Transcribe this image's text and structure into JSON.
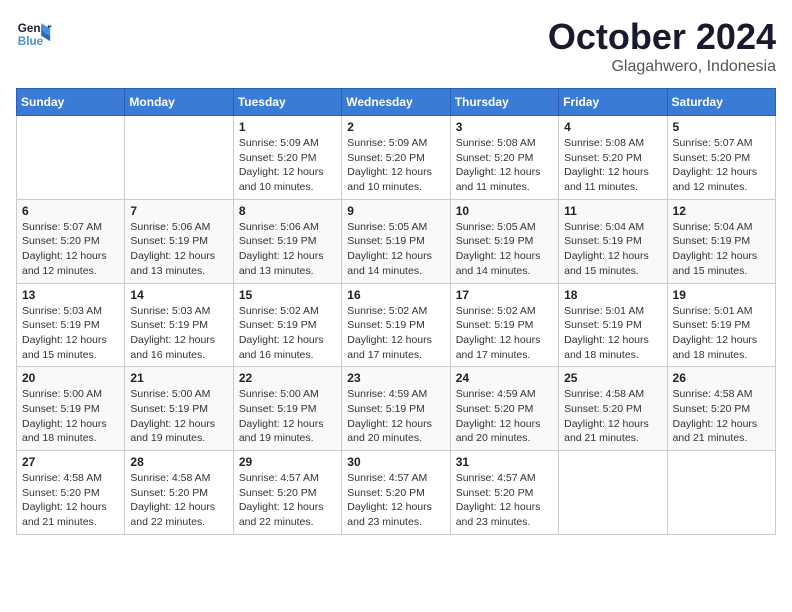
{
  "header": {
    "logo_line1": "General",
    "logo_line2": "Blue",
    "month": "October 2024",
    "location": "Glagahwero, Indonesia"
  },
  "weekdays": [
    "Sunday",
    "Monday",
    "Tuesday",
    "Wednesday",
    "Thursday",
    "Friday",
    "Saturday"
  ],
  "weeks": [
    [
      {
        "day": "",
        "info": ""
      },
      {
        "day": "",
        "info": ""
      },
      {
        "day": "1",
        "info": "Sunrise: 5:09 AM\nSunset: 5:20 PM\nDaylight: 12 hours\nand 10 minutes."
      },
      {
        "day": "2",
        "info": "Sunrise: 5:09 AM\nSunset: 5:20 PM\nDaylight: 12 hours\nand 10 minutes."
      },
      {
        "day": "3",
        "info": "Sunrise: 5:08 AM\nSunset: 5:20 PM\nDaylight: 12 hours\nand 11 minutes."
      },
      {
        "day": "4",
        "info": "Sunrise: 5:08 AM\nSunset: 5:20 PM\nDaylight: 12 hours\nand 11 minutes."
      },
      {
        "day": "5",
        "info": "Sunrise: 5:07 AM\nSunset: 5:20 PM\nDaylight: 12 hours\nand 12 minutes."
      }
    ],
    [
      {
        "day": "6",
        "info": "Sunrise: 5:07 AM\nSunset: 5:20 PM\nDaylight: 12 hours\nand 12 minutes."
      },
      {
        "day": "7",
        "info": "Sunrise: 5:06 AM\nSunset: 5:19 PM\nDaylight: 12 hours\nand 13 minutes."
      },
      {
        "day": "8",
        "info": "Sunrise: 5:06 AM\nSunset: 5:19 PM\nDaylight: 12 hours\nand 13 minutes."
      },
      {
        "day": "9",
        "info": "Sunrise: 5:05 AM\nSunset: 5:19 PM\nDaylight: 12 hours\nand 14 minutes."
      },
      {
        "day": "10",
        "info": "Sunrise: 5:05 AM\nSunset: 5:19 PM\nDaylight: 12 hours\nand 14 minutes."
      },
      {
        "day": "11",
        "info": "Sunrise: 5:04 AM\nSunset: 5:19 PM\nDaylight: 12 hours\nand 15 minutes."
      },
      {
        "day": "12",
        "info": "Sunrise: 5:04 AM\nSunset: 5:19 PM\nDaylight: 12 hours\nand 15 minutes."
      }
    ],
    [
      {
        "day": "13",
        "info": "Sunrise: 5:03 AM\nSunset: 5:19 PM\nDaylight: 12 hours\nand 15 minutes."
      },
      {
        "day": "14",
        "info": "Sunrise: 5:03 AM\nSunset: 5:19 PM\nDaylight: 12 hours\nand 16 minutes."
      },
      {
        "day": "15",
        "info": "Sunrise: 5:02 AM\nSunset: 5:19 PM\nDaylight: 12 hours\nand 16 minutes."
      },
      {
        "day": "16",
        "info": "Sunrise: 5:02 AM\nSunset: 5:19 PM\nDaylight: 12 hours\nand 17 minutes."
      },
      {
        "day": "17",
        "info": "Sunrise: 5:02 AM\nSunset: 5:19 PM\nDaylight: 12 hours\nand 17 minutes."
      },
      {
        "day": "18",
        "info": "Sunrise: 5:01 AM\nSunset: 5:19 PM\nDaylight: 12 hours\nand 18 minutes."
      },
      {
        "day": "19",
        "info": "Sunrise: 5:01 AM\nSunset: 5:19 PM\nDaylight: 12 hours\nand 18 minutes."
      }
    ],
    [
      {
        "day": "20",
        "info": "Sunrise: 5:00 AM\nSunset: 5:19 PM\nDaylight: 12 hours\nand 18 minutes."
      },
      {
        "day": "21",
        "info": "Sunrise: 5:00 AM\nSunset: 5:19 PM\nDaylight: 12 hours\nand 19 minutes."
      },
      {
        "day": "22",
        "info": "Sunrise: 5:00 AM\nSunset: 5:19 PM\nDaylight: 12 hours\nand 19 minutes."
      },
      {
        "day": "23",
        "info": "Sunrise: 4:59 AM\nSunset: 5:19 PM\nDaylight: 12 hours\nand 20 minutes."
      },
      {
        "day": "24",
        "info": "Sunrise: 4:59 AM\nSunset: 5:20 PM\nDaylight: 12 hours\nand 20 minutes."
      },
      {
        "day": "25",
        "info": "Sunrise: 4:58 AM\nSunset: 5:20 PM\nDaylight: 12 hours\nand 21 minutes."
      },
      {
        "day": "26",
        "info": "Sunrise: 4:58 AM\nSunset: 5:20 PM\nDaylight: 12 hours\nand 21 minutes."
      }
    ],
    [
      {
        "day": "27",
        "info": "Sunrise: 4:58 AM\nSunset: 5:20 PM\nDaylight: 12 hours\nand 21 minutes."
      },
      {
        "day": "28",
        "info": "Sunrise: 4:58 AM\nSunset: 5:20 PM\nDaylight: 12 hours\nand 22 minutes."
      },
      {
        "day": "29",
        "info": "Sunrise: 4:57 AM\nSunset: 5:20 PM\nDaylight: 12 hours\nand 22 minutes."
      },
      {
        "day": "30",
        "info": "Sunrise: 4:57 AM\nSunset: 5:20 PM\nDaylight: 12 hours\nand 23 minutes."
      },
      {
        "day": "31",
        "info": "Sunrise: 4:57 AM\nSunset: 5:20 PM\nDaylight: 12 hours\nand 23 minutes."
      },
      {
        "day": "",
        "info": ""
      },
      {
        "day": "",
        "info": ""
      }
    ]
  ]
}
